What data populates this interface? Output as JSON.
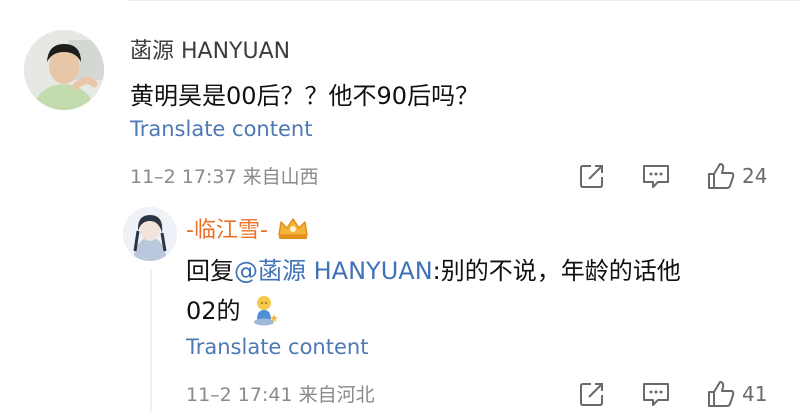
{
  "comments": [
    {
      "username": "菡源 HANYUAN",
      "text": "黄明昊是00后？？他不90后吗？",
      "translate_label": "Translate content",
      "meta": "11–2 17:37  来自山西",
      "like_count": "24",
      "avatar_icon": "boy-portrait-avatar"
    }
  ],
  "reply": {
    "username": "-临江雪-",
    "badge_icon": "crown-badge-icon",
    "prefix": "回复",
    "mention": "@菡源 HANYUAN",
    "text_line1": ":别的不说，年龄的话他",
    "text_line2": "02的",
    "emoji_icon": "sitting-figure-emoji",
    "translate_label": "Translate content",
    "meta": "11–2 17:41  来自河北",
    "like_count": "41",
    "avatar_icon": "anime-girl-avatar"
  },
  "colors": {
    "accent_link": "#4d79b4",
    "reply_name": "#ea7228"
  }
}
